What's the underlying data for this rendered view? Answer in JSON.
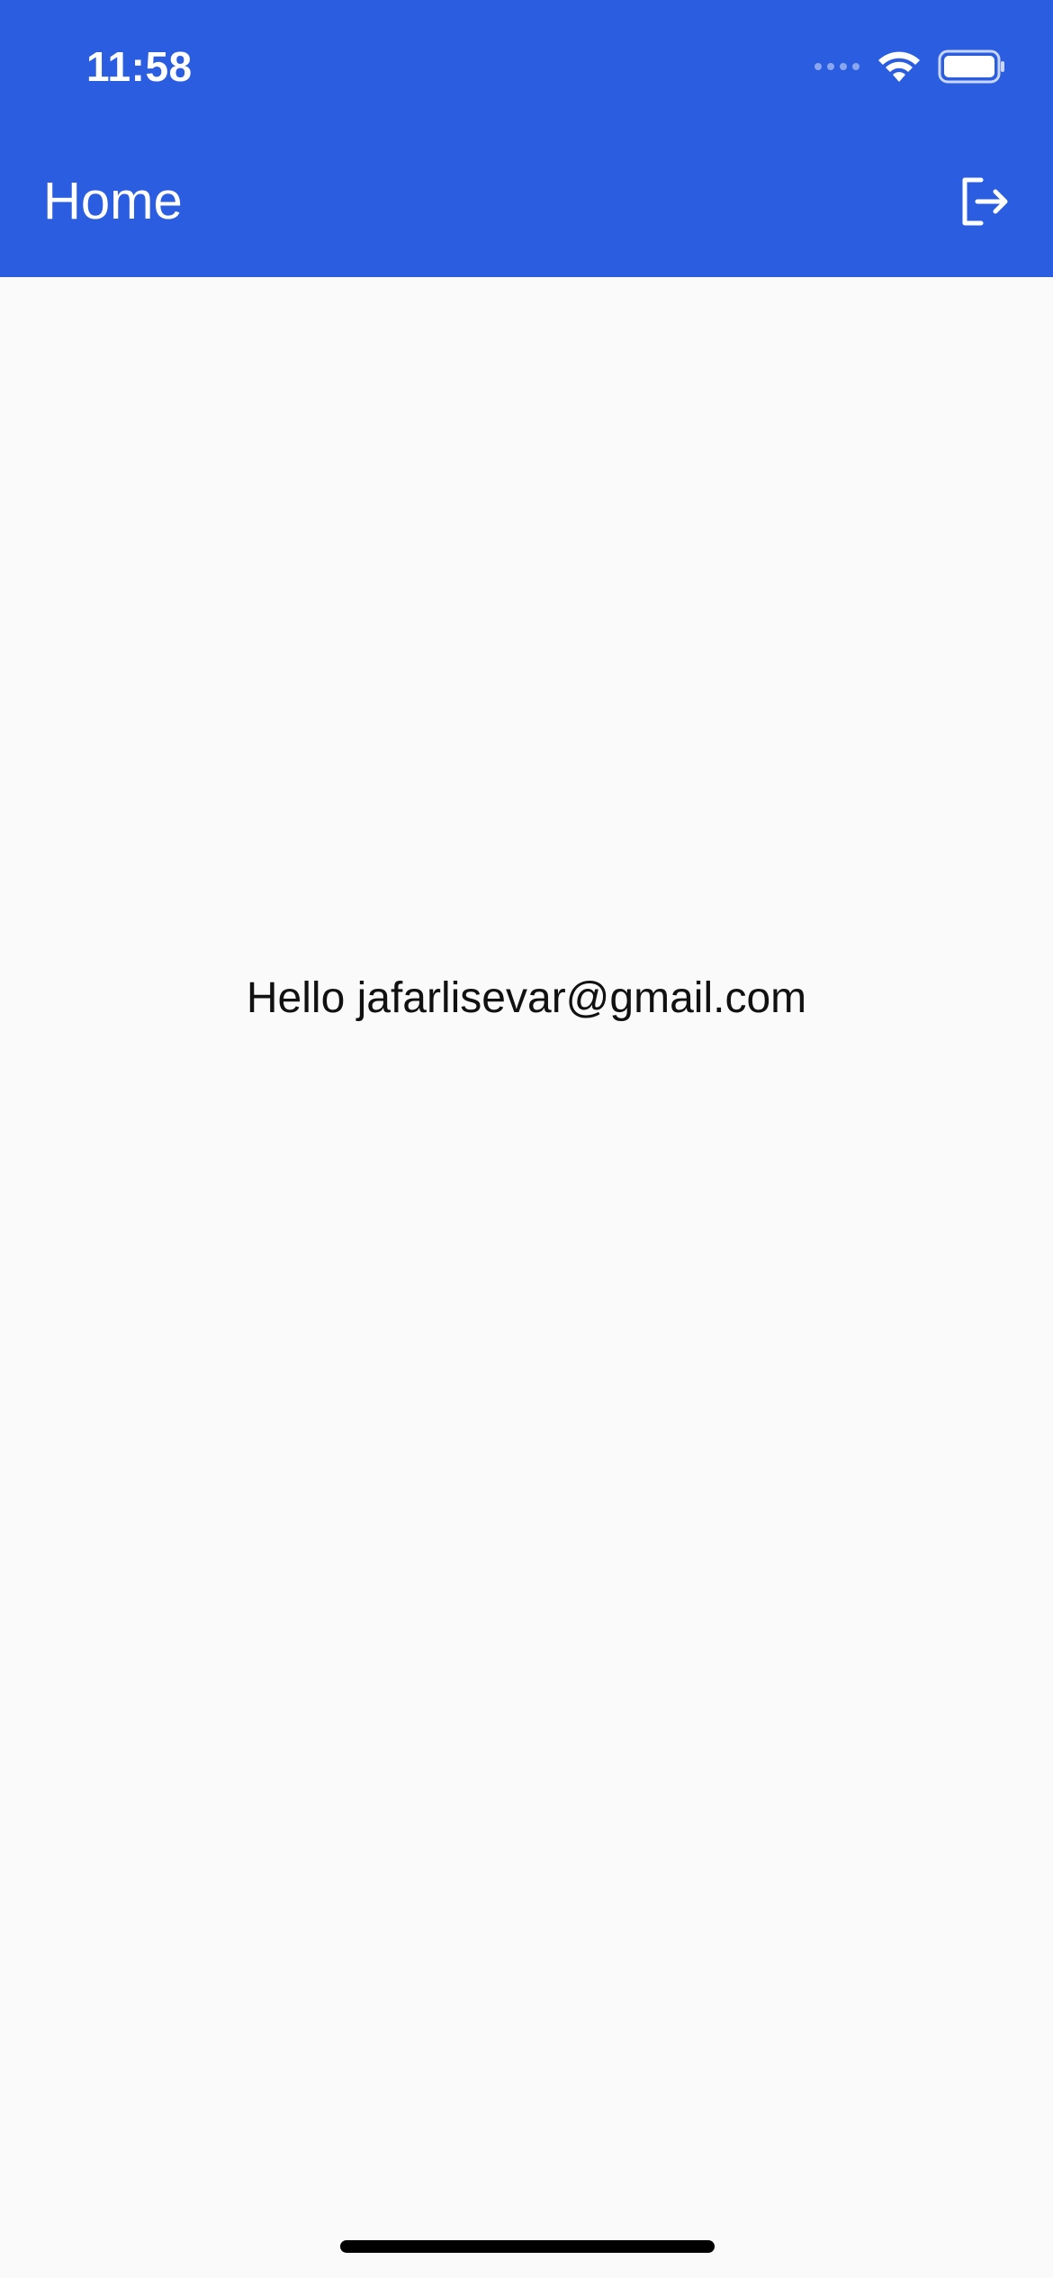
{
  "status_bar": {
    "time": "11:58",
    "icons": [
      "signal-icon",
      "wifi-icon",
      "battery-icon"
    ]
  },
  "app_bar": {
    "title": "Home",
    "action_icon": "logout-icon",
    "background_color": "#2a5de0"
  },
  "content": {
    "greeting": "Hello jafarlisevar@gmail.com"
  },
  "colors": {
    "accent": "#2a5de0",
    "page_background": "#fafafa",
    "text": "#111111"
  }
}
